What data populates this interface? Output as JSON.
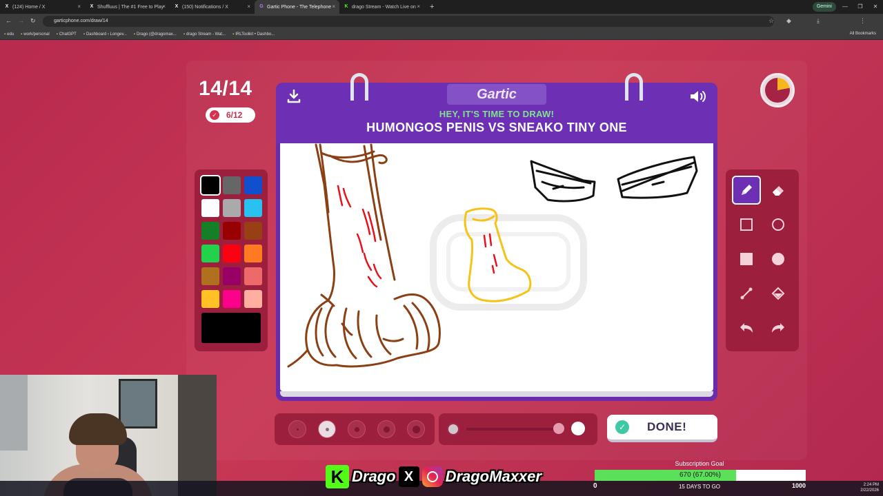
{
  "browser": {
    "tabs": [
      {
        "label": "(124) Home / X",
        "icon": "x-icon",
        "active": false
      },
      {
        "label": "Shuffluus | The #1 Free to Play",
        "icon": "x-icon",
        "active": false
      },
      {
        "label": "(150) Notifications / X",
        "icon": "x-icon",
        "active": false
      },
      {
        "label": "Gartic Phone - The Telephone",
        "icon": "gartic-icon",
        "active": true
      },
      {
        "label": "drago Stream - Watch Live on",
        "icon": "kick-icon",
        "active": false
      }
    ],
    "gemini_label": "Gemini",
    "url": "garticphone.com/draw/14",
    "bookmarks": [
      "edu",
      "work/personal",
      "ChatGPT",
      "Dashboard ‹ Longev...",
      "Drago (@dragomax...",
      "drago Stream - Wat...",
      "IRLToolkit • Dashbo..."
    ],
    "all_bookmarks": "All Bookmarks"
  },
  "game": {
    "round": "14/14",
    "progress": "6/12",
    "logo": "Gartic",
    "prompt_intro": "HEY, IT'S TIME TO DRAW!",
    "prompt": "HUMONGOS PENIS VS SNEAKO TINY ONE",
    "done_label": "DONE!",
    "timer_fraction_elapsed": 0.22,
    "colors": [
      "#000000",
      "#666666",
      "#1150cc",
      "#ffffff",
      "#aaaaaa",
      "#29c1f0",
      "#137f27",
      "#990000",
      "#993f15",
      "#22d24a",
      "#ff0013",
      "#ff7a20",
      "#b07020",
      "#990066",
      "#ee6a6a",
      "#ffc126",
      "#ff008c",
      "#ffaea0"
    ],
    "selected_color": "#000000",
    "brush_sizes": 5,
    "selected_brush_size": 2
  },
  "overlay": {
    "kick_handle": "Drago",
    "insta_handle": "DragoMaxxer",
    "subgoal_title": "Subscription Goal",
    "subgoal_value": "670 (67.00%)",
    "subgoal_fraction": 0.67,
    "subgoal_min": "0",
    "subgoal_max": "1000",
    "subgoal_days": "15 DAYS TO GO",
    "clock_time": "2:24 PM",
    "clock_date": "2/22/2026"
  }
}
